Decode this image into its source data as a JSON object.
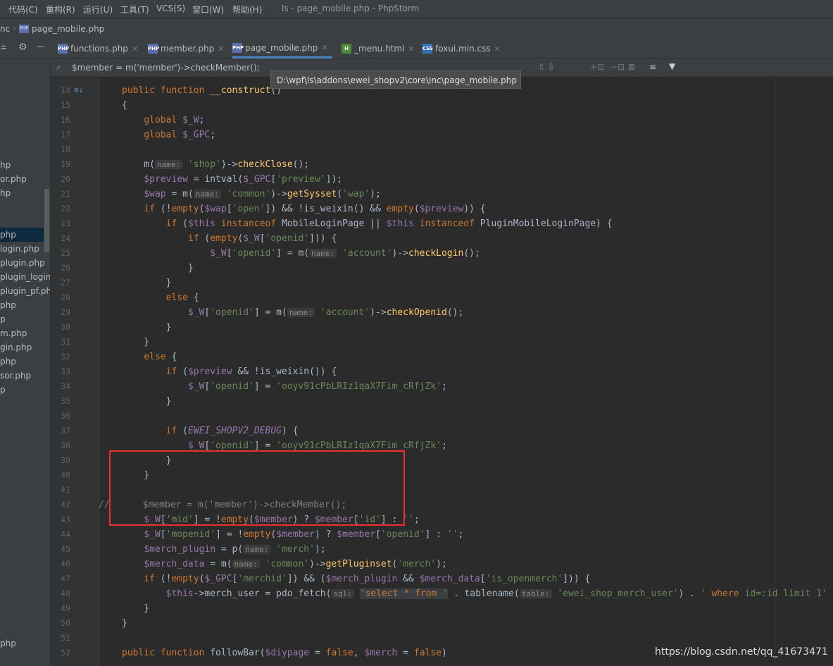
{
  "menubar": {
    "items": [
      "代码(C)",
      "重构(R)",
      "运行(U)",
      "工具(T)",
      "VCS(S)",
      "窗口(W)",
      "帮助(H)"
    ],
    "window_title": "ls - page_mobile.php - PhpStorm"
  },
  "breadcrumb": {
    "parent": "nc",
    "file": "page_mobile.php"
  },
  "tabs": [
    {
      "label": "functions.php",
      "icon": "php-file-icon"
    },
    {
      "label": "member.php",
      "icon": "php-file-icon"
    },
    {
      "label": "page_mobile.php",
      "icon": "php-file-icon",
      "active": true
    },
    {
      "label": "_menu.html",
      "icon": "html-file-icon"
    },
    {
      "label": "foxui.min.css",
      "icon": "css-file-icon"
    }
  ],
  "search": {
    "query": "$member = m('member')->checkMember();"
  },
  "tooltip": {
    "path": "D:\\wpf\\ls\\addons\\ewei_shopv2\\core\\inc\\page_mobile.php"
  },
  "sidebar": {
    "items": [
      "hp",
      "or.php",
      "hp",
      "php",
      "login.php",
      "plugin.php",
      "plugin_login.",
      "plugin_pf.php",
      "php",
      "p",
      "m.php",
      "gin.php",
      "php",
      "sor.php",
      "p",
      "php"
    ]
  },
  "editor": {
    "line_numbers": [
      "14",
      "15",
      "16",
      "17",
      "18",
      "19",
      "20",
      "21",
      "22",
      "23",
      "24",
      "25",
      "26",
      "27",
      "28",
      "29",
      "30",
      "31",
      "32",
      "33",
      "34",
      "35",
      "36",
      "37",
      "38",
      "39",
      "40",
      "41",
      "42",
      "43",
      "44",
      "45",
      "46",
      "47",
      "48",
      "49",
      "50",
      "51",
      "52"
    ]
  },
  "watermark": "https://blog.csdn.net/qq_41673471",
  "colors": {
    "highlight_box": "#e8312f",
    "editor_bg": "#2b2b2b",
    "keyword": "#cc7832",
    "variable": "#9876aa",
    "string": "#6a8759",
    "function": "#ffc66d"
  }
}
